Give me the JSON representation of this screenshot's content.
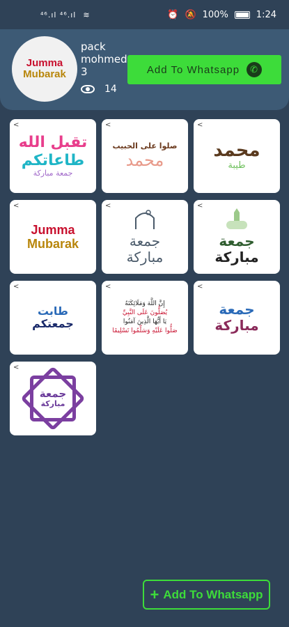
{
  "status_bar": {
    "signal_left": "⁴⁶.ıl ⁴⁶.ıl",
    "battery": "100%",
    "time": "1:24"
  },
  "header": {
    "avatar_line1": "Jumma",
    "avatar_line2": "Mubarak",
    "pack_line1": "pack",
    "pack_line2": "mohmed",
    "pack_line3": "3",
    "views": "14",
    "add_button_label": "Add To Whatsapp"
  },
  "stickers": [
    {
      "l1": "تقبل الله",
      "l2": "طاعاتكم",
      "l3": "جمعة مباركة"
    },
    {
      "l1": "صلوا على الحبيب",
      "l2": "محمد"
    },
    {
      "l1": "محمد",
      "l2": "طيبة"
    },
    {
      "l1": "Jumma",
      "l2": "Mubarak"
    },
    {
      "l1": "جمعة",
      "l2": "مباركة"
    },
    {
      "l1": "جمعة",
      "l2": "مباركة"
    },
    {
      "l1": "طابت",
      "l2": "جمعتكم"
    },
    {
      "l1": "إِنَّ اللَّهَ وَمَلَائِكَتَهُ",
      "l2": "يُصَلُّونَ عَلَى النَّبِيِّ",
      "l3": "يَا أَيُّهَا الَّذِينَ آمَنُوا",
      "l4": "صَلُّوا عَلَيْهِ وَسَلِّمُوا تَسْلِيمًا"
    },
    {
      "l1": "جمعة",
      "l2": "مباركة"
    },
    {
      "l1": "جمعة",
      "l2": "مباركة"
    }
  ],
  "share_icon": "share-icon",
  "footer": {
    "add_button_label": "Add To Whatsapp"
  },
  "colors": {
    "background": "#2f4257",
    "header": "#3d5a75",
    "accent_green": "#3ddc3a"
  }
}
